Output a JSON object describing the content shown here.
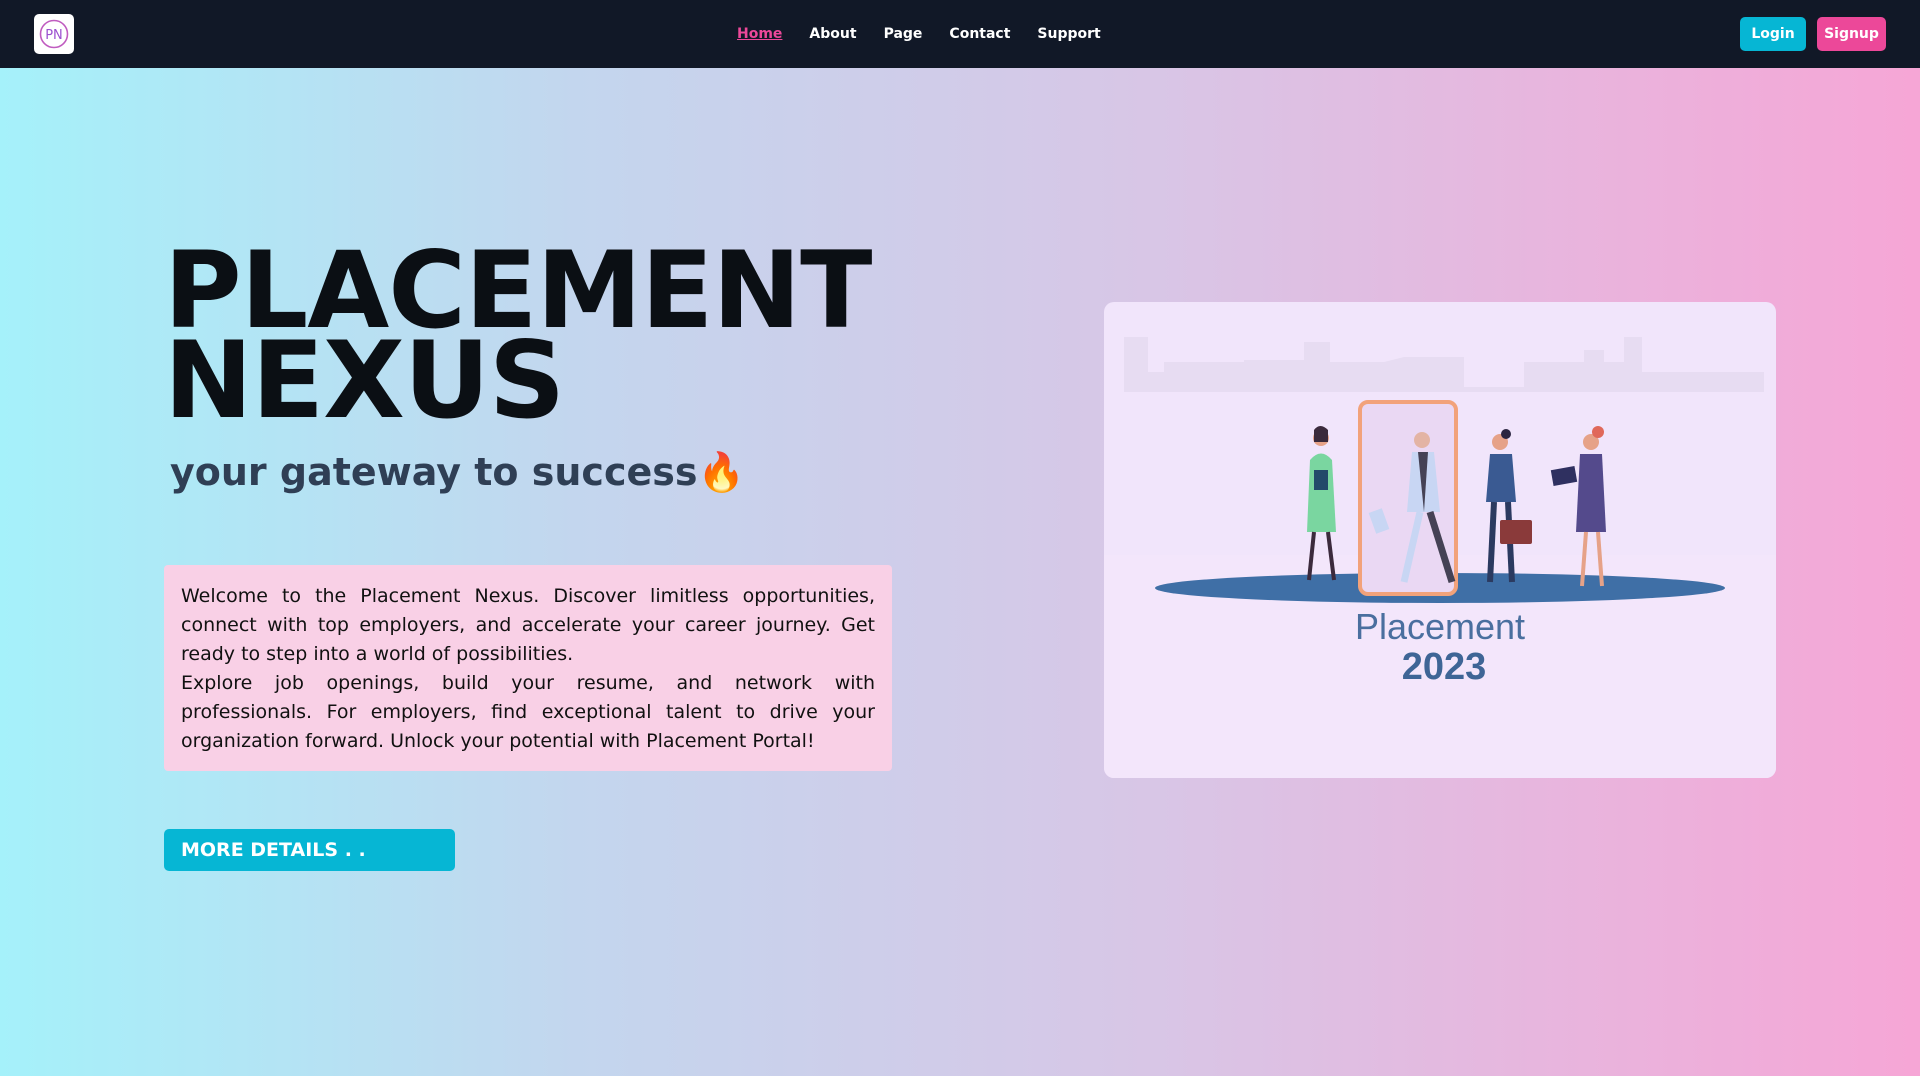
{
  "brand": {
    "logo_text": "PN"
  },
  "nav": {
    "links": [
      "Home",
      "About",
      "Page",
      "Contact",
      "Support"
    ],
    "active": "Home"
  },
  "auth": {
    "login": "Login",
    "signup": "Signup"
  },
  "hero": {
    "title_line1": "PLACEMENT",
    "title_line2": "NEXUS",
    "subtitle": "your gateway to success🔥",
    "paragraph1": "Welcome to the Placement Nexus. Discover limitless opportunities, connect with top employers, and accelerate your career journey. Get ready to step into a world of possibilities.",
    "paragraph2": "Explore job openings, build your resume, and network with professionals. For employers, find exceptional talent to drive your organization forward. Unlock your potential with Placement Portal!",
    "cta": "MORE DETAILS . ."
  },
  "illustration": {
    "caption_line1": "Placement",
    "caption_line2": "2023"
  },
  "colors": {
    "nav_bg": "#111827",
    "accent_pink": "#ec4899",
    "accent_cyan": "#06b6d4"
  }
}
